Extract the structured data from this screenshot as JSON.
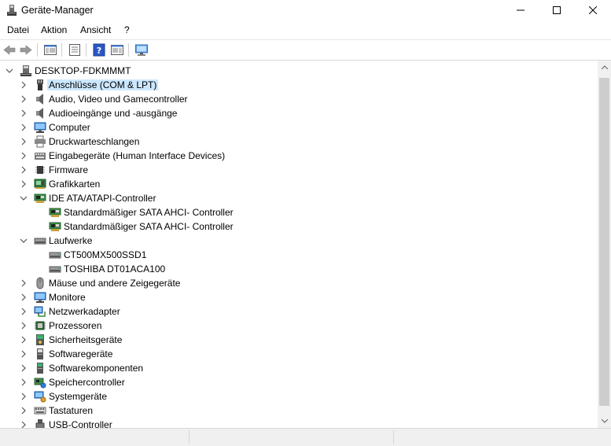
{
  "window": {
    "title": "Geräte-Manager",
    "minimize_glyph": "—",
    "maximize_glyph": "☐",
    "close_glyph": "✕"
  },
  "menu": [
    {
      "label": "Datei"
    },
    {
      "label": "Aktion"
    },
    {
      "label": "Ansicht"
    },
    {
      "label": "?"
    }
  ],
  "toolbar": {
    "buttons": [
      {
        "name": "back-icon"
      },
      {
        "name": "forward-icon"
      },
      {
        "name": "show-hide-console-tree-icon"
      },
      {
        "name": "properties-icon"
      },
      {
        "name": "help-icon"
      },
      {
        "name": "action-pane-icon"
      },
      {
        "name": "scan-hardware-icon"
      }
    ]
  },
  "tree": {
    "root": "DESKTOP-FDKMMMT",
    "categories": [
      {
        "label": "Anschlüsse (COM & LPT)",
        "icon": "ports-icon",
        "expanded": false,
        "selected": true,
        "children": []
      },
      {
        "label": "Audio, Video und Gamecontroller",
        "icon": "speaker-icon",
        "expanded": false,
        "children": []
      },
      {
        "label": "Audioeingänge und -ausgänge",
        "icon": "speaker-icon",
        "expanded": false,
        "children": []
      },
      {
        "label": "Computer",
        "icon": "monitor-icon",
        "expanded": false,
        "children": []
      },
      {
        "label": "Druckwarteschlangen",
        "icon": "printer-icon",
        "expanded": false,
        "children": []
      },
      {
        "label": "Eingabegeräte (Human Interface Devices)",
        "icon": "hid-icon",
        "expanded": false,
        "children": []
      },
      {
        "label": "Firmware",
        "icon": "chip-icon",
        "expanded": false,
        "children": []
      },
      {
        "label": "Grafikkarten",
        "icon": "display-adapter-icon",
        "expanded": false,
        "children": []
      },
      {
        "label": "IDE ATA/ATAPI-Controller",
        "icon": "controller-card-icon",
        "expanded": true,
        "children": [
          {
            "label": "Standardmäßiger SATA AHCI- Controller",
            "icon": "controller-card-icon"
          },
          {
            "label": "Standardmäßiger SATA AHCI- Controller",
            "icon": "controller-card-icon"
          }
        ]
      },
      {
        "label": "Laufwerke",
        "icon": "disk-drive-icon",
        "expanded": true,
        "children": [
          {
            "label": "CT500MX500SSD1",
            "icon": "disk-drive-icon"
          },
          {
            "label": "TOSHIBA DT01ACA100",
            "icon": "disk-drive-icon"
          }
        ]
      },
      {
        "label": "Mäuse und andere Zeigegeräte",
        "icon": "mouse-icon",
        "expanded": false,
        "children": []
      },
      {
        "label": "Monitore",
        "icon": "monitor-icon",
        "expanded": false,
        "children": []
      },
      {
        "label": "Netzwerkadapter",
        "icon": "network-adapter-icon",
        "expanded": false,
        "children": []
      },
      {
        "label": "Prozessoren",
        "icon": "processor-icon",
        "expanded": false,
        "children": []
      },
      {
        "label": "Sicherheitsgeräte",
        "icon": "security-device-icon",
        "expanded": false,
        "children": []
      },
      {
        "label": "Softwaregeräte",
        "icon": "software-device-icon",
        "expanded": false,
        "children": []
      },
      {
        "label": "Softwarekomponenten",
        "icon": "software-component-icon",
        "expanded": false,
        "children": []
      },
      {
        "label": "Speichercontroller",
        "icon": "storage-controller-icon",
        "expanded": false,
        "children": []
      },
      {
        "label": "Systemgeräte",
        "icon": "system-device-icon",
        "expanded": false,
        "children": []
      },
      {
        "label": "Tastaturen",
        "icon": "keyboard-icon",
        "expanded": false,
        "children": []
      },
      {
        "label": "USB-Controller",
        "icon": "usb-icon",
        "expanded": false,
        "children": []
      }
    ]
  },
  "colors": {
    "selection": "#cce8ff",
    "scrollbar_track": "#f0f0f0",
    "scrollbar_thumb": "#cdcdcd"
  }
}
